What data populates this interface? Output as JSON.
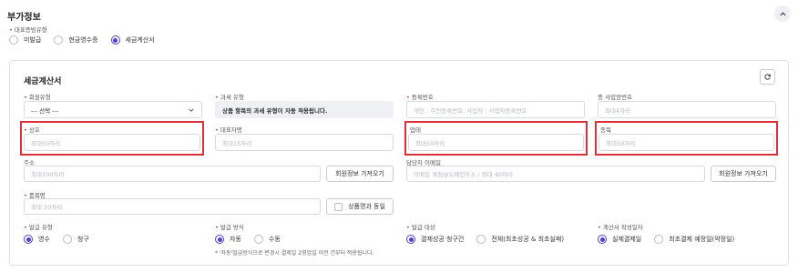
{
  "section": {
    "title": "부가정보",
    "receipt_type_label": "대표증빙유형",
    "receipt_options": [
      "미발급",
      "현금영수증",
      "세금계산서"
    ],
    "receipt_selected": 2
  },
  "card": {
    "title": "세금계산서",
    "member_type": {
      "label": "회원유형",
      "value": "--- 선택 ---"
    },
    "tax_type": {
      "label": "과세 유형",
      "value": "상품 항목의 과세 유형이 자동 적용됩니다."
    },
    "reg_number": {
      "label": "등록번호",
      "placeholder": "개인 : 주민등록번호, 사업자 : 사업자등록번호"
    },
    "sub_business_number": {
      "label": "종 사업장번호",
      "placeholder": "최대4자리"
    },
    "company_name": {
      "label": "상호",
      "placeholder": "최대50자리"
    },
    "ceo_name": {
      "label": "대표자명",
      "placeholder": "최대15자리"
    },
    "business_type": {
      "label": "업태",
      "placeholder": "최대50자리"
    },
    "business_item": {
      "label": "종목",
      "placeholder": "최대50자리"
    },
    "address": {
      "label": "주소",
      "placeholder": "최대100자리",
      "button": "회원정보 가져오기"
    },
    "manager_email": {
      "label": "담당자 이메일",
      "placeholder": "이메일 계정@도메인주소 / 최대 40자리",
      "button": "회원정보 가져오기"
    },
    "product_name": {
      "label": "품목명",
      "placeholder": "최대 50자리",
      "same_label": "상품명과 동일"
    },
    "issue_type": {
      "label": "발급 유형",
      "options": [
        "영수",
        "청구"
      ],
      "selected": 0
    },
    "issue_method": {
      "label": "발급 방식",
      "options": [
        "자동",
        "수동"
      ],
      "selected": 0,
      "note": "* '자동'발급방식으로 변경시 결제일 2영업일 이전 건부터 적용됩니다."
    },
    "issue_target": {
      "label": "발급 대상",
      "options": [
        "결제성공 청구건",
        "전체(최초성공 & 최초실패)"
      ],
      "selected": 0
    },
    "write_date": {
      "label": "계산서 작성일자",
      "options": [
        "실제결제일",
        "최초결제 예정일(약정일)"
      ],
      "selected": 0
    }
  }
}
